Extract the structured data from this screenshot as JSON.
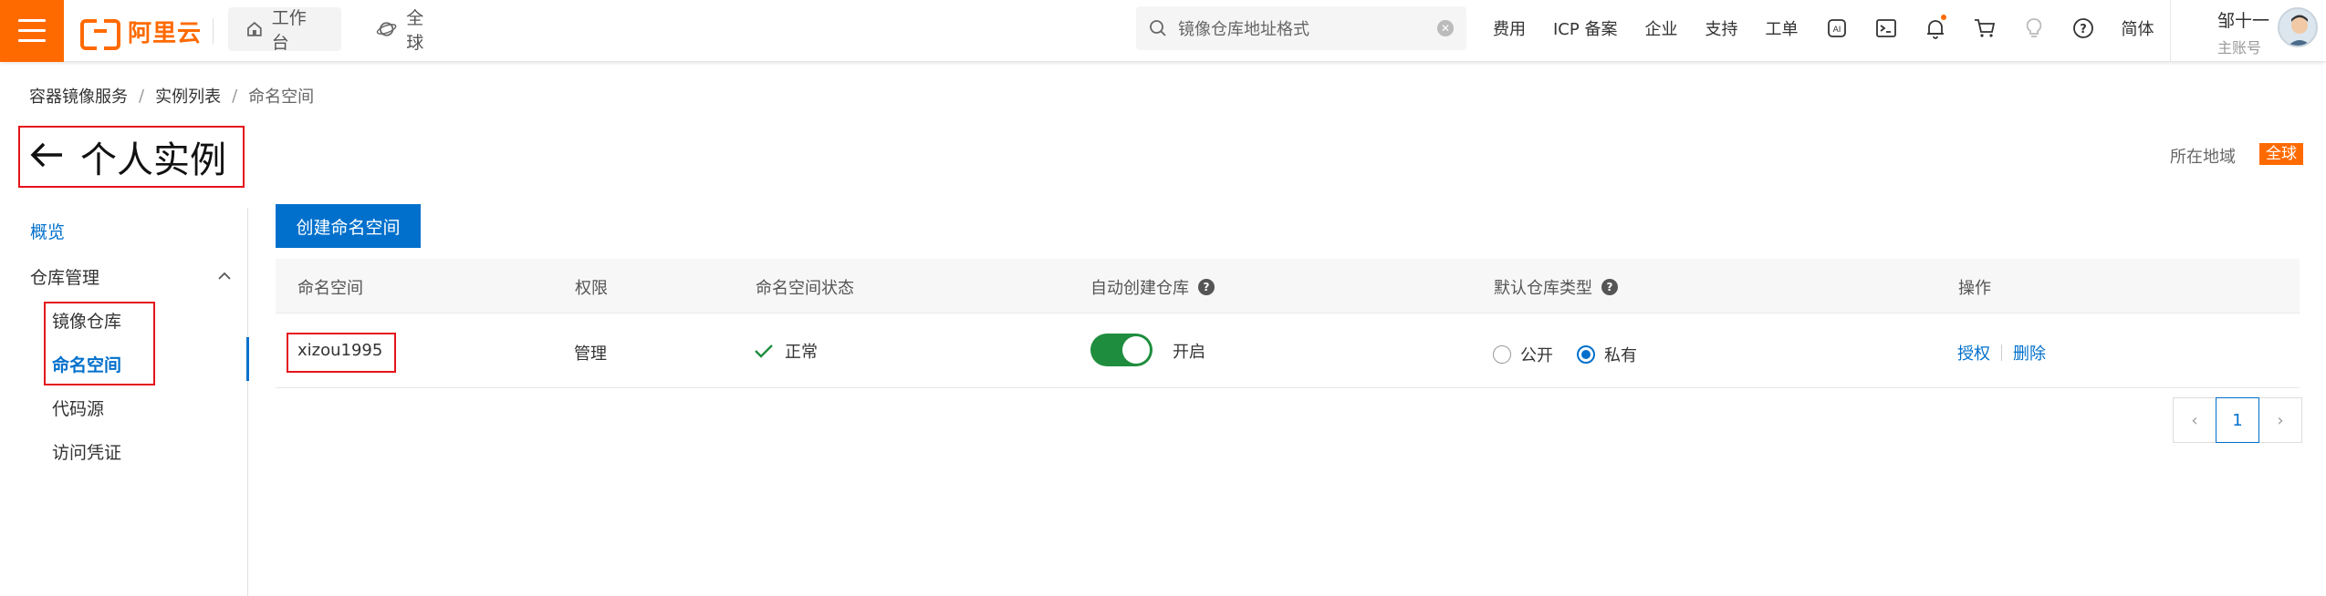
{
  "topbar": {
    "logo_text": "阿里云",
    "workbench_label": "工作台",
    "region_label": "全球",
    "search_placeholder": "镜像仓库地址格式",
    "links": [
      "费用",
      "ICP 备案",
      "企业",
      "支持",
      "工单"
    ],
    "icons": [
      "ai-assistant-icon",
      "terminal-icon",
      "bell-icon",
      "cart-icon",
      "lightbulb-icon",
      "help-icon"
    ],
    "language": "简体",
    "user_name": "邹十一",
    "user_role": "主账号"
  },
  "breadcrumb": [
    "容器镜像服务",
    "实例列表",
    "命名空间"
  ],
  "page_title": "个人实例",
  "region": {
    "label": "所在地域",
    "value": "全球"
  },
  "sidebar": {
    "overview": "概览",
    "repo_management": "仓库管理",
    "items": [
      "镜像仓库",
      "命名空间",
      "代码源",
      "访问凭证"
    ],
    "active": "命名空间"
  },
  "toolbar": {
    "create_label": "创建命名空间"
  },
  "table": {
    "headers": [
      "命名空间",
      "权限",
      "命名空间状态",
      "自动创建仓库",
      "默认仓库类型",
      "操作"
    ],
    "rows": [
      {
        "namespace": "xizou1995",
        "permission": "管理",
        "status": "正常",
        "auto_create": "开启",
        "auto_create_on": true,
        "repo_type_public": "公开",
        "repo_type_private": "私有",
        "repo_type_selected": "私有",
        "actions": [
          "授权",
          "删除"
        ]
      }
    ]
  },
  "pagination": {
    "current_page": "1",
    "prev": "‹",
    "next": "›"
  },
  "colors": {
    "brand": "#ff6a00",
    "primary": "#0070cc",
    "toggle_on": "#1e8e3e",
    "highlight_box": "#e4141b"
  }
}
